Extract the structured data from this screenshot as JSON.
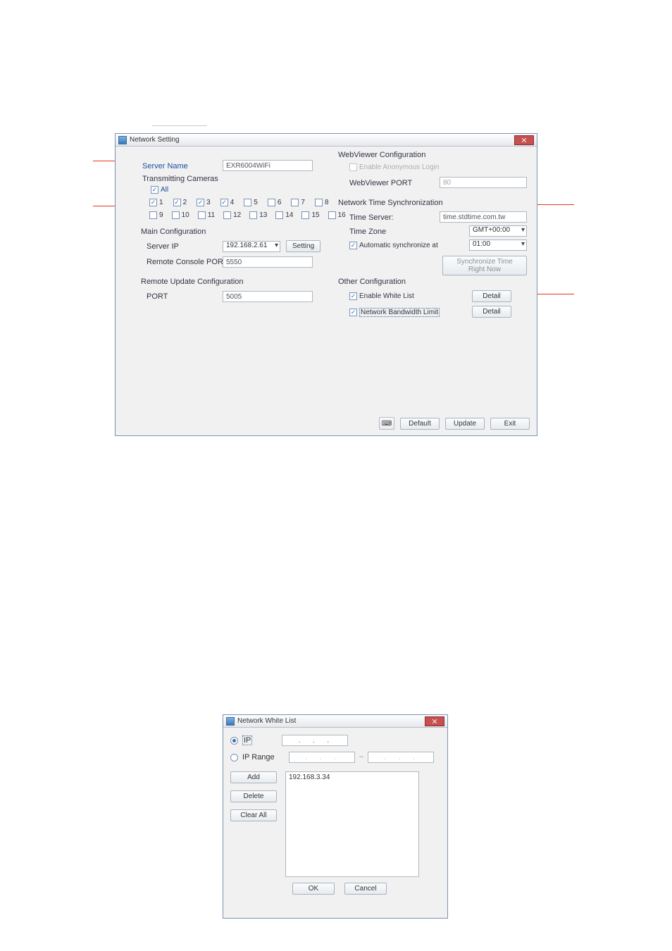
{
  "dialog1": {
    "title": "Network Setting",
    "serverNameLabel": "Server Name",
    "serverNameValue": "EXR6004WiFi",
    "transmittingCamerasLabel": "Transmitting Cameras",
    "allLabel": "All",
    "cameras": {
      "c1": "1",
      "c2": "2",
      "c3": "3",
      "c4": "4",
      "c5": "5",
      "c6": "6",
      "c7": "7",
      "c8": "8",
      "c9": "9",
      "c10": "10",
      "c11": "11",
      "c12": "12",
      "c13": "13",
      "c14": "14",
      "c15": "15",
      "c16": "16"
    },
    "mainConfigLabel": "Main Configuration",
    "serverIpLabel": "Server IP",
    "serverIpValue": "192.168.2.61",
    "settingBtn": "Setting",
    "remoteConsolePortLabel": "Remote Console PORT",
    "remoteConsolePortValue": "5550",
    "remoteUpdateConfigLabel": "Remote Update Configuration",
    "ruPortLabel": "PORT",
    "ruPortValue": "5005",
    "webviewerConfigLabel": "WebViewer Configuration",
    "enableAnonymousLabel": "Enable Anonymous Login",
    "webviewerPortLabel": "WebViewer PORT",
    "webviewerPortValue": "80",
    "ntsLabel": "Network Time Synchronization",
    "timeServerLabel": "Time Server:",
    "timeServerValue": "time.stdtime.com.tw",
    "timeZoneLabel": "Time Zone",
    "timeZoneValue": "GMT+00:00",
    "autoSyncLabel": "Automatic synchronize at",
    "autoSyncValue": "01:00",
    "syncNowBtn": "Synchronize Time Right Now",
    "otherConfigLabel": "Other Configuration",
    "enableWhiteListLabel": "Enable White List",
    "detailBtn": "Detail",
    "networkBandwidthLabel": "Network Bandwidth Limit",
    "defaultBtn": "Default",
    "updateBtn": "Update",
    "exitBtn": "Exit"
  },
  "dialog2": {
    "title": "Network White List",
    "ipLabel": "IP",
    "ipRangeLabel": "IP Range",
    "addBtn": "Add",
    "deleteBtn": "Delete",
    "clearAllBtn": "Clear All",
    "listEntry1": "192.168.3.34",
    "okBtn": "OK",
    "cancelBtn": "Cancel"
  }
}
